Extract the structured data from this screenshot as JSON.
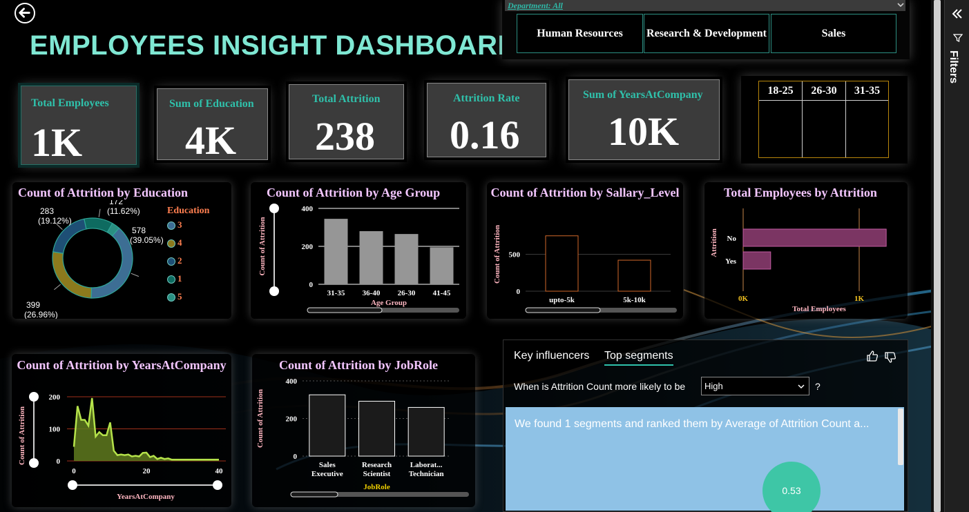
{
  "header": {
    "title": "EMPLOYEES INSIGHT DASHBOARD"
  },
  "department_slicer": {
    "label": "Department: All",
    "options": [
      "Human Resources",
      "Research & Development",
      "Sales"
    ]
  },
  "kpis": {
    "total_employees": {
      "label": "Total Employees",
      "value": "1K"
    },
    "sum_education": {
      "label": "Sum of Education",
      "value": "4K"
    },
    "total_attrition": {
      "label": "Total Attrition",
      "value": "238"
    },
    "attrition_rate": {
      "label": "Attrition Rate",
      "value": "0.16"
    },
    "sum_years": {
      "label": "Sum of YearsAtCompany",
      "value": "10K"
    }
  },
  "age_slicer": {
    "headers": [
      "18-25",
      "26-30",
      "31-35"
    ]
  },
  "filters_pane": {
    "label": "Filters"
  },
  "colors": {
    "accent": "#7fe7d3",
    "card_title": "#f3c6ff",
    "bar_gray": "#969696",
    "line_green": "#b5e34a"
  },
  "chart_data": [
    {
      "type": "pie",
      "title": "Count of Attrition by Education",
      "legend_title": "Education",
      "legend": [
        "3",
        "4",
        "2",
        "1",
        "5"
      ],
      "slices": [
        {
          "category": "3",
          "value": 578,
          "label": "578",
          "pct": "(39.05%)",
          "color": "#3d6e94"
        },
        {
          "category": "4",
          "value": 399,
          "label": "399",
          "pct": "(26.96%)",
          "color": "#8c7a1d"
        },
        {
          "category": "2",
          "value": 283,
          "label": "283",
          "pct": "(19.12%)",
          "color": "#1e4f75"
        },
        {
          "category": "1",
          "value": 172,
          "label": "172",
          "pct": "(11.62%)",
          "color": "#0e6b60"
        },
        {
          "category": "5",
          "value": 48,
          "label": "",
          "pct": "",
          "color": "#2a8f81"
        }
      ]
    },
    {
      "type": "bar",
      "title": "Count of Attrition by Age Group",
      "categories": [
        "31-35",
        "36-40",
        "26-30",
        "41-45"
      ],
      "values": [
        345,
        280,
        265,
        195
      ],
      "xlabel": "Age Group",
      "ylabel": "Count of Attrition",
      "ylim": [
        0,
        400
      ],
      "yticks": [
        "0",
        "200",
        "400"
      ]
    },
    {
      "type": "bar",
      "title": "Count of Attrition by Sallary_Level",
      "categories": [
        "upto-5k",
        "5k-10k"
      ],
      "values": [
        750,
        420
      ],
      "xlabel": "",
      "ylabel": "Count of Attrition",
      "ylim": [
        0,
        1000
      ],
      "yticks": [
        "0",
        "500"
      ]
    },
    {
      "type": "bar",
      "orientation": "horizontal",
      "title": "Total Employees by Attrition",
      "categories": [
        "No",
        "Yes"
      ],
      "values": [
        1233,
        237
      ],
      "xlabel": "Total Employees",
      "ylabel": "Attrition",
      "xlim": [
        0,
        1400
      ],
      "xticks": [
        "0K",
        "1K"
      ]
    },
    {
      "type": "area",
      "title": "Count of Attrition by YearsAtCompany",
      "x": [
        0,
        1,
        2,
        3,
        4,
        5,
        6,
        7,
        8,
        9,
        10,
        11,
        12,
        13,
        14,
        15,
        16,
        17,
        18,
        19,
        20,
        21,
        22,
        23,
        24,
        25,
        26,
        27,
        28,
        29,
        30,
        31,
        32,
        33,
        34,
        35,
        36,
        37,
        38,
        39,
        40
      ],
      "values": [
        44,
        171,
        128,
        128,
        110,
        196,
        76,
        90,
        80,
        80,
        120,
        32,
        18,
        20,
        18,
        20,
        14,
        16,
        14,
        25,
        26,
        12,
        16,
        6,
        10,
        6,
        8,
        4,
        4,
        4,
        4,
        4,
        4,
        4,
        4,
        4,
        4,
        4,
        4,
        4,
        4
      ],
      "xlabel": "YearsAtCompany",
      "ylabel": "Count of Attrition",
      "ylim": [
        0,
        220
      ],
      "yticks": [
        "0",
        "100",
        "200"
      ],
      "xticks": [
        "0",
        "20",
        "40"
      ]
    },
    {
      "type": "bar",
      "title": "Count of Attrition by JobRole",
      "categories": [
        "Sales Executive",
        "Research Scientist",
        "Laborat... Technician"
      ],
      "values": [
        326,
        292,
        259
      ],
      "xlabel": "JobRole",
      "ylabel": "Count of Attrition",
      "ylim": [
        0,
        400
      ],
      "yticks": [
        "0",
        "200",
        "400"
      ]
    }
  ],
  "key_influencers": {
    "tabs": [
      "Key influencers",
      "Top segments"
    ],
    "question": "When is Attrition Count more likely to be",
    "question_mark": "?",
    "selected": "High",
    "message": "We found 1 segments and ranked them by Average of Attrition Count a...",
    "segment_value": "0.53"
  }
}
